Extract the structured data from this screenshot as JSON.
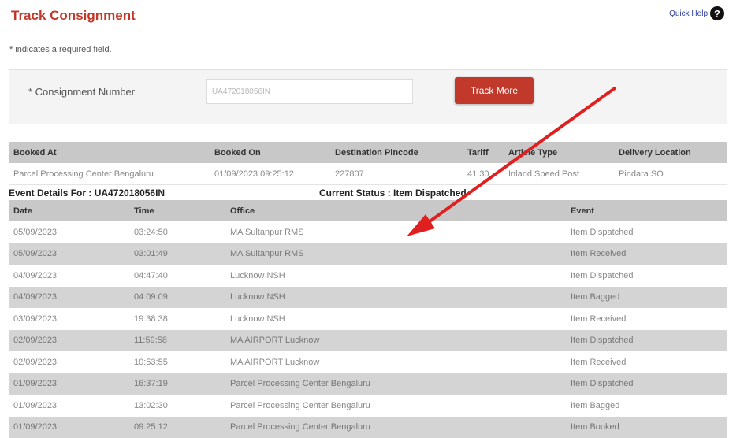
{
  "header": {
    "title": "Track Consignment",
    "help_link": "Quick Help",
    "help_icon": "?"
  },
  "required_note": "* indicates a required field.",
  "form": {
    "label": "* Consignment Number",
    "input_value": "UA472018056IN",
    "button_label": "Track More"
  },
  "booking": {
    "headers": [
      "Booked At",
      "Booked On",
      "Destination Pincode",
      "Tariff",
      "Article Type",
      "Delivery Location"
    ],
    "row": [
      "Parcel Processing Center Bengaluru",
      "01/09/2023 09:25:12",
      "227807",
      "41.30",
      "Inland Speed Post",
      "Pindara SO"
    ]
  },
  "event_section": {
    "event_details": "Event Details For : UA472018056IN",
    "current_status": "Current Status : Item Dispatched"
  },
  "events": {
    "headers": [
      "Date",
      "Time",
      "Office",
      "Event"
    ],
    "rows": [
      [
        "05/09/2023",
        "03:24:50",
        "MA Sultanpur RMS",
        "Item Dispatched"
      ],
      [
        "05/09/2023",
        "03:01:49",
        "MA Sultanpur RMS",
        "Item Received"
      ],
      [
        "04/09/2023",
        "04:47:40",
        "Lucknow NSH",
        "Item Dispatched"
      ],
      [
        "04/09/2023",
        "04:09:09",
        "Lucknow NSH",
        "Item Bagged"
      ],
      [
        "03/09/2023",
        "19:38:38",
        "Lucknow NSH",
        "Item Received"
      ],
      [
        "02/09/2023",
        "11:59:58",
        "MA AIRPORT Lucknow",
        "Item Dispatched"
      ],
      [
        "02/09/2023",
        "10:53:55",
        "MA AIRPORT Lucknow",
        "Item Received"
      ],
      [
        "01/09/2023",
        "16:37:19",
        "Parcel Processing Center Bengaluru",
        "Item Dispatched"
      ],
      [
        "01/09/2023",
        "13:02:30",
        "Parcel Processing Center Bengaluru",
        "Item Bagged"
      ],
      [
        "01/09/2023",
        "09:25:12",
        "Parcel Processing Center Bengaluru",
        "Item Booked"
      ]
    ]
  },
  "annotation": {
    "arrow_color": "#e02020"
  }
}
